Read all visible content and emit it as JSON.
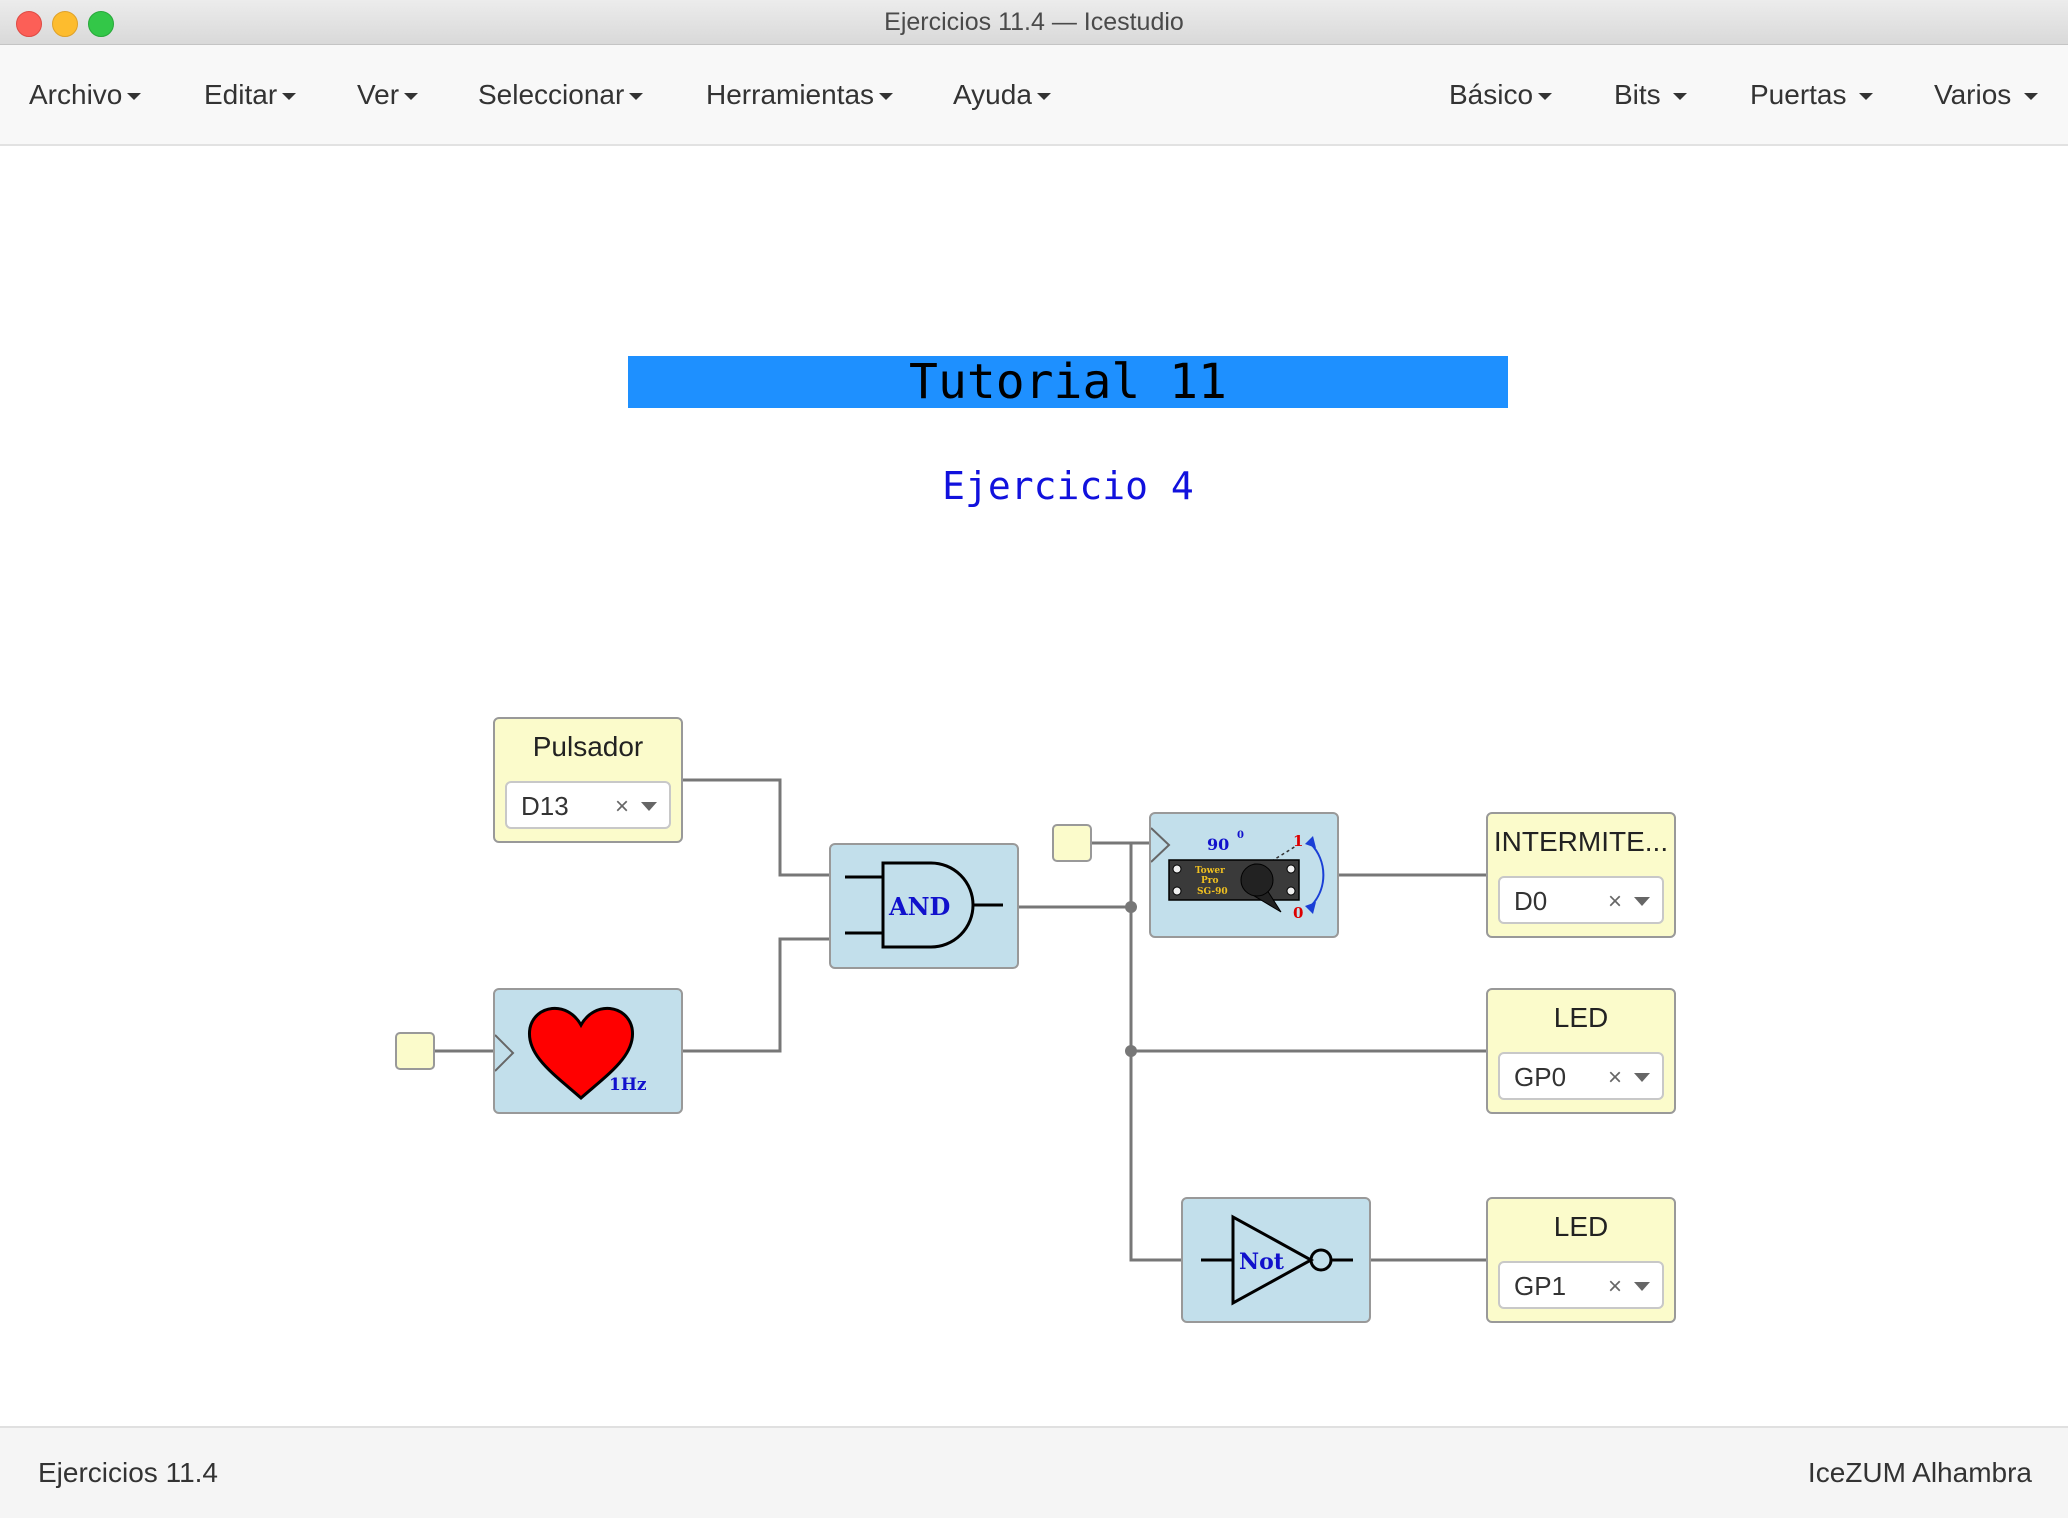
{
  "window": {
    "title": "Ejercicios 11.4 — Icestudio"
  },
  "menu": {
    "left": [
      "Archivo",
      "Editar",
      "Ver",
      "Seleccionar",
      "Herramientas",
      "Ayuda"
    ],
    "right": [
      "Básico",
      "Bits",
      "Puertas",
      "Varios"
    ]
  },
  "canvas": {
    "title": "Tutorial 11",
    "subtitle": "Ejercicio 4",
    "title_color": "#1e90ff",
    "blocks": {
      "pulsador": {
        "label": "Pulsador",
        "pin": "D13"
      },
      "intermitente": {
        "label": "INTERMITE...",
        "pin": "D0"
      },
      "led1": {
        "label": "LED",
        "pin": "GP0"
      },
      "led2": {
        "label": "LED",
        "pin": "GP1"
      },
      "and_gate": {
        "text": "AND"
      },
      "not_gate": {
        "text": "Not"
      },
      "heart": {
        "text": "1Hz"
      },
      "servo": {
        "angle": "90",
        "degree": "0",
        "high": "1",
        "low": "0",
        "brand1": "Tower",
        "brand2": "Pro",
        "model": "SG-90"
      }
    },
    "colors": {
      "io_block": "#fbfbcb",
      "logic_block": "#c2dfeb",
      "wire": "#777777"
    }
  },
  "status": {
    "left": "Ejercicios 11.4",
    "right": "IceZUM Alhambra"
  }
}
